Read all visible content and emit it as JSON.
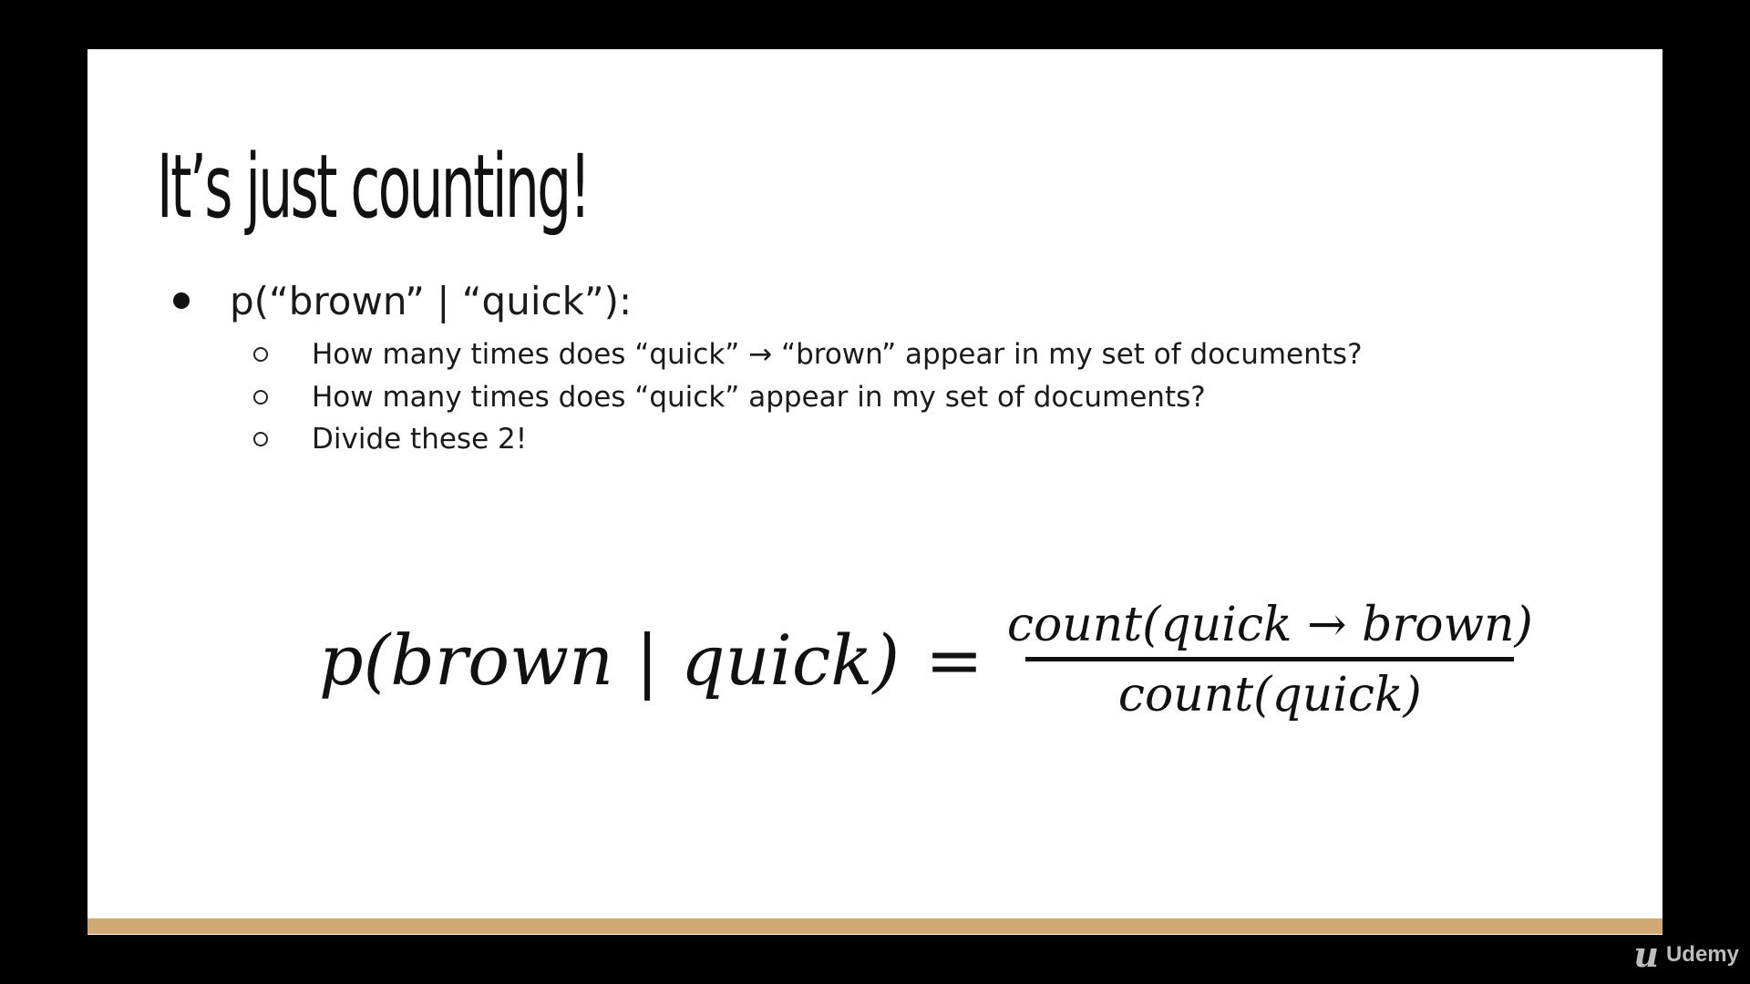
{
  "slide": {
    "title": "It’s just counting!",
    "bullet": {
      "text": "p(“brown” | “quick”):",
      "sub_items": [
        {
          "text": "How many times does “quick” → “brown” appear in my set of documents?"
        },
        {
          "text": "How many times does “quick” appear in my set of documents?"
        },
        {
          "text": "Divide these 2!"
        }
      ]
    },
    "formula": {
      "lhs": "p(brown | quick)",
      "equals": "=",
      "numerator": "count(quick → brown)",
      "denominator": "count(quick)"
    }
  },
  "brand": {
    "logo_icon": "udemy-logo-icon",
    "name": "Udemy"
  },
  "colors": {
    "background": "#000000",
    "slide": "#ffffff",
    "accent": "#d0a874",
    "brand": "#bdbdbd"
  }
}
